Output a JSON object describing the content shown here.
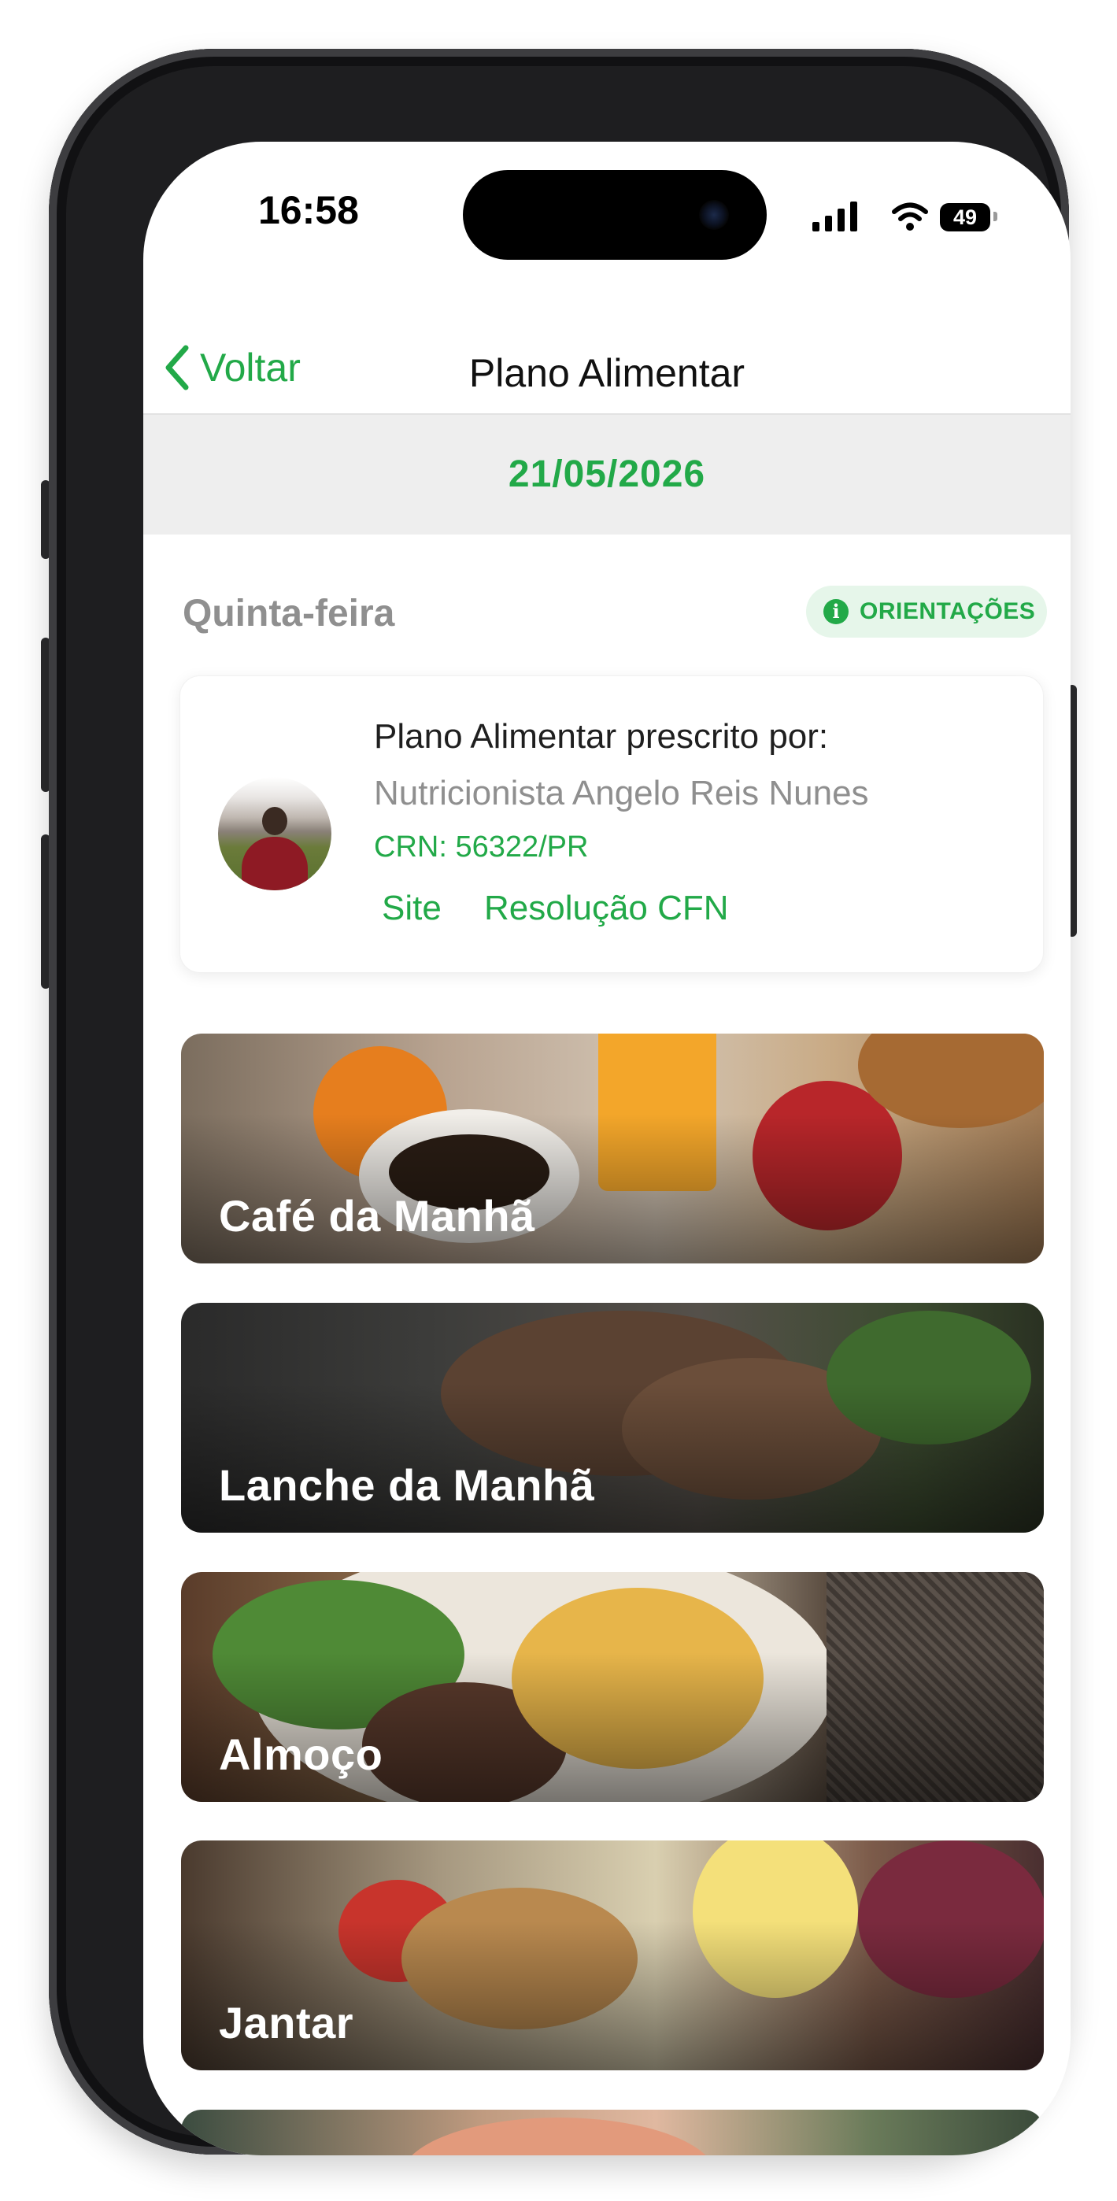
{
  "status_bar": {
    "time": "16:58",
    "battery": "49"
  },
  "nav": {
    "back_label": "Voltar",
    "title": "Plano Alimentar"
  },
  "date": "21/05/2026",
  "weekday": "Quinta-feira",
  "orientacoes_label": "ORIENTAÇÕES",
  "prescriber_card": {
    "title": "Plano Alimentar prescrito por:",
    "name": "Nutricionista Angelo Reis Nunes",
    "crn": "CRN: 56322/PR",
    "links": [
      "Site",
      "Resolução CFN"
    ]
  },
  "meals": [
    "Café da Manhã",
    "Lanche da Manhã",
    "Almoço",
    "Jantar",
    ""
  ],
  "colors": {
    "accent": "#22a948",
    "band": "#eeeeee",
    "muted_text": "#8f8f8f"
  },
  "icons": [
    "chevron-left-icon",
    "info-icon",
    "signal-icon",
    "wifi-icon",
    "battery-icon"
  ]
}
